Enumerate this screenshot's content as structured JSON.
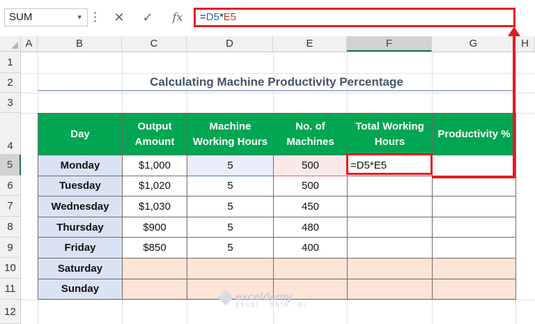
{
  "name_box": {
    "value": "SUM"
  },
  "formula_bar": {
    "cancel_icon": "✕",
    "enter_icon": "✓",
    "fx_label": "fx",
    "formula_prefix": "=",
    "formula_ref1": "D5",
    "formula_op": "*",
    "formula_ref2": "E5"
  },
  "columns": [
    "A",
    "B",
    "C",
    "D",
    "E",
    "F",
    "G",
    "H"
  ],
  "rows": [
    "1",
    "2",
    "3",
    "4",
    "5",
    "6",
    "7",
    "8",
    "9",
    "10",
    "11",
    "12"
  ],
  "title": "Calculating Machine Productivity Percentage",
  "table": {
    "headers": [
      "Day",
      "Output Amount",
      "Machine Working Hours",
      "No. of Machines",
      "Total Working Hours",
      "Productivity %"
    ],
    "rows": [
      [
        "Monday",
        "$1,000",
        "5",
        "500",
        "=D5*E5",
        ""
      ],
      [
        "Tuesday",
        "$1,020",
        "5",
        "500",
        "",
        ""
      ],
      [
        "Wednesday",
        "$1,030",
        "5",
        "450",
        "",
        ""
      ],
      [
        "Thursday",
        "$900",
        "5",
        "480",
        "",
        ""
      ],
      [
        "Friday",
        "$850",
        "5",
        "400",
        "",
        ""
      ],
      [
        "Saturday",
        "",
        "",
        "",
        "",
        ""
      ],
      [
        "Sunday",
        "",
        "",
        "",
        "",
        ""
      ]
    ]
  },
  "watermark": {
    "name": "exceldemy",
    "tagline": "EXCEL · DATA · BI"
  },
  "colors": {
    "header_green": "#00a651",
    "highlight_red": "#e31b23",
    "day_blue": "#dae3f3",
    "empty_peach": "#fce4d6"
  }
}
